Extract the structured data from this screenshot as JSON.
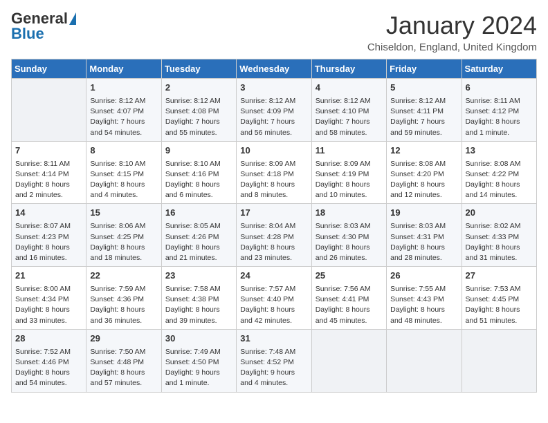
{
  "header": {
    "logo_general": "General",
    "logo_blue": "Blue",
    "title": "January 2024",
    "location": "Chiseldon, England, United Kingdom"
  },
  "days_of_week": [
    "Sunday",
    "Monday",
    "Tuesday",
    "Wednesday",
    "Thursday",
    "Friday",
    "Saturday"
  ],
  "weeks": [
    [
      {
        "day": "",
        "content": ""
      },
      {
        "day": "1",
        "content": "Sunrise: 8:12 AM\nSunset: 4:07 PM\nDaylight: 7 hours\nand 54 minutes."
      },
      {
        "day": "2",
        "content": "Sunrise: 8:12 AM\nSunset: 4:08 PM\nDaylight: 7 hours\nand 55 minutes."
      },
      {
        "day": "3",
        "content": "Sunrise: 8:12 AM\nSunset: 4:09 PM\nDaylight: 7 hours\nand 56 minutes."
      },
      {
        "day": "4",
        "content": "Sunrise: 8:12 AM\nSunset: 4:10 PM\nDaylight: 7 hours\nand 58 minutes."
      },
      {
        "day": "5",
        "content": "Sunrise: 8:12 AM\nSunset: 4:11 PM\nDaylight: 7 hours\nand 59 minutes."
      },
      {
        "day": "6",
        "content": "Sunrise: 8:11 AM\nSunset: 4:12 PM\nDaylight: 8 hours\nand 1 minute."
      }
    ],
    [
      {
        "day": "7",
        "content": "Sunrise: 8:11 AM\nSunset: 4:14 PM\nDaylight: 8 hours\nand 2 minutes."
      },
      {
        "day": "8",
        "content": "Sunrise: 8:10 AM\nSunset: 4:15 PM\nDaylight: 8 hours\nand 4 minutes."
      },
      {
        "day": "9",
        "content": "Sunrise: 8:10 AM\nSunset: 4:16 PM\nDaylight: 8 hours\nand 6 minutes."
      },
      {
        "day": "10",
        "content": "Sunrise: 8:09 AM\nSunset: 4:18 PM\nDaylight: 8 hours\nand 8 minutes."
      },
      {
        "day": "11",
        "content": "Sunrise: 8:09 AM\nSunset: 4:19 PM\nDaylight: 8 hours\nand 10 minutes."
      },
      {
        "day": "12",
        "content": "Sunrise: 8:08 AM\nSunset: 4:20 PM\nDaylight: 8 hours\nand 12 minutes."
      },
      {
        "day": "13",
        "content": "Sunrise: 8:08 AM\nSunset: 4:22 PM\nDaylight: 8 hours\nand 14 minutes."
      }
    ],
    [
      {
        "day": "14",
        "content": "Sunrise: 8:07 AM\nSunset: 4:23 PM\nDaylight: 8 hours\nand 16 minutes."
      },
      {
        "day": "15",
        "content": "Sunrise: 8:06 AM\nSunset: 4:25 PM\nDaylight: 8 hours\nand 18 minutes."
      },
      {
        "day": "16",
        "content": "Sunrise: 8:05 AM\nSunset: 4:26 PM\nDaylight: 8 hours\nand 21 minutes."
      },
      {
        "day": "17",
        "content": "Sunrise: 8:04 AM\nSunset: 4:28 PM\nDaylight: 8 hours\nand 23 minutes."
      },
      {
        "day": "18",
        "content": "Sunrise: 8:03 AM\nSunset: 4:30 PM\nDaylight: 8 hours\nand 26 minutes."
      },
      {
        "day": "19",
        "content": "Sunrise: 8:03 AM\nSunset: 4:31 PM\nDaylight: 8 hours\nand 28 minutes."
      },
      {
        "day": "20",
        "content": "Sunrise: 8:02 AM\nSunset: 4:33 PM\nDaylight: 8 hours\nand 31 minutes."
      }
    ],
    [
      {
        "day": "21",
        "content": "Sunrise: 8:00 AM\nSunset: 4:34 PM\nDaylight: 8 hours\nand 33 minutes."
      },
      {
        "day": "22",
        "content": "Sunrise: 7:59 AM\nSunset: 4:36 PM\nDaylight: 8 hours\nand 36 minutes."
      },
      {
        "day": "23",
        "content": "Sunrise: 7:58 AM\nSunset: 4:38 PM\nDaylight: 8 hours\nand 39 minutes."
      },
      {
        "day": "24",
        "content": "Sunrise: 7:57 AM\nSunset: 4:40 PM\nDaylight: 8 hours\nand 42 minutes."
      },
      {
        "day": "25",
        "content": "Sunrise: 7:56 AM\nSunset: 4:41 PM\nDaylight: 8 hours\nand 45 minutes."
      },
      {
        "day": "26",
        "content": "Sunrise: 7:55 AM\nSunset: 4:43 PM\nDaylight: 8 hours\nand 48 minutes."
      },
      {
        "day": "27",
        "content": "Sunrise: 7:53 AM\nSunset: 4:45 PM\nDaylight: 8 hours\nand 51 minutes."
      }
    ],
    [
      {
        "day": "28",
        "content": "Sunrise: 7:52 AM\nSunset: 4:46 PM\nDaylight: 8 hours\nand 54 minutes."
      },
      {
        "day": "29",
        "content": "Sunrise: 7:50 AM\nSunset: 4:48 PM\nDaylight: 8 hours\nand 57 minutes."
      },
      {
        "day": "30",
        "content": "Sunrise: 7:49 AM\nSunset: 4:50 PM\nDaylight: 9 hours\nand 1 minute."
      },
      {
        "day": "31",
        "content": "Sunrise: 7:48 AM\nSunset: 4:52 PM\nDaylight: 9 hours\nand 4 minutes."
      },
      {
        "day": "",
        "content": ""
      },
      {
        "day": "",
        "content": ""
      },
      {
        "day": "",
        "content": ""
      }
    ]
  ]
}
